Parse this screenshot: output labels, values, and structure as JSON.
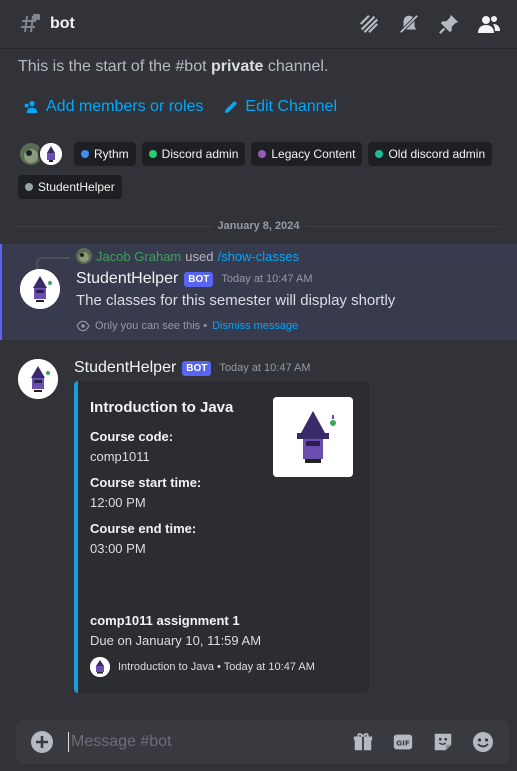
{
  "header": {
    "title": "bot"
  },
  "intro": {
    "prefix": "This is the start of the #bot ",
    "bold": "private",
    "suffix": " channel."
  },
  "actions": {
    "add_members": "Add members or roles",
    "edit_channel": "Edit Channel"
  },
  "roles": [
    {
      "label": "Rythm",
      "color": "#3a8ff0"
    },
    {
      "label": "Discord admin",
      "color": "#2ecc71"
    },
    {
      "label": "Legacy Content",
      "color": "#9b59b6"
    },
    {
      "label": "Old discord admin",
      "color": "#1abc9c"
    },
    {
      "label": "StudentHelper",
      "color": "#95a5a6"
    }
  ],
  "divider": {
    "date": "January 8, 2024"
  },
  "message1": {
    "reply_user": "Jacob Graham",
    "reply_used": "used",
    "reply_command": "/show-classes",
    "author": "StudentHelper",
    "badge": "BOT",
    "time": "Today at 10:47 AM",
    "text": "The classes for this semester will display shortly",
    "ephemeral_note": "Only you can see this •",
    "dismiss": "Dismiss message"
  },
  "message2": {
    "author": "StudentHelper",
    "badge": "BOT",
    "time": "Today at 10:47 AM",
    "embed": {
      "title": "Introduction to Java",
      "accent": "#1a9dd9",
      "fields": [
        {
          "name": "Course code:",
          "value": "comp1011"
        },
        {
          "name": "Course start time:",
          "value": "12:00 PM"
        },
        {
          "name": "Course end time:",
          "value": "03:00 PM"
        },
        {
          "name": "comp1011 assignment 1",
          "value": "Due on January 10, 11:59 AM"
        }
      ],
      "footer": "Introduction to Java • Today at 10:47 AM"
    }
  },
  "composer": {
    "placeholder": "Message #bot"
  }
}
